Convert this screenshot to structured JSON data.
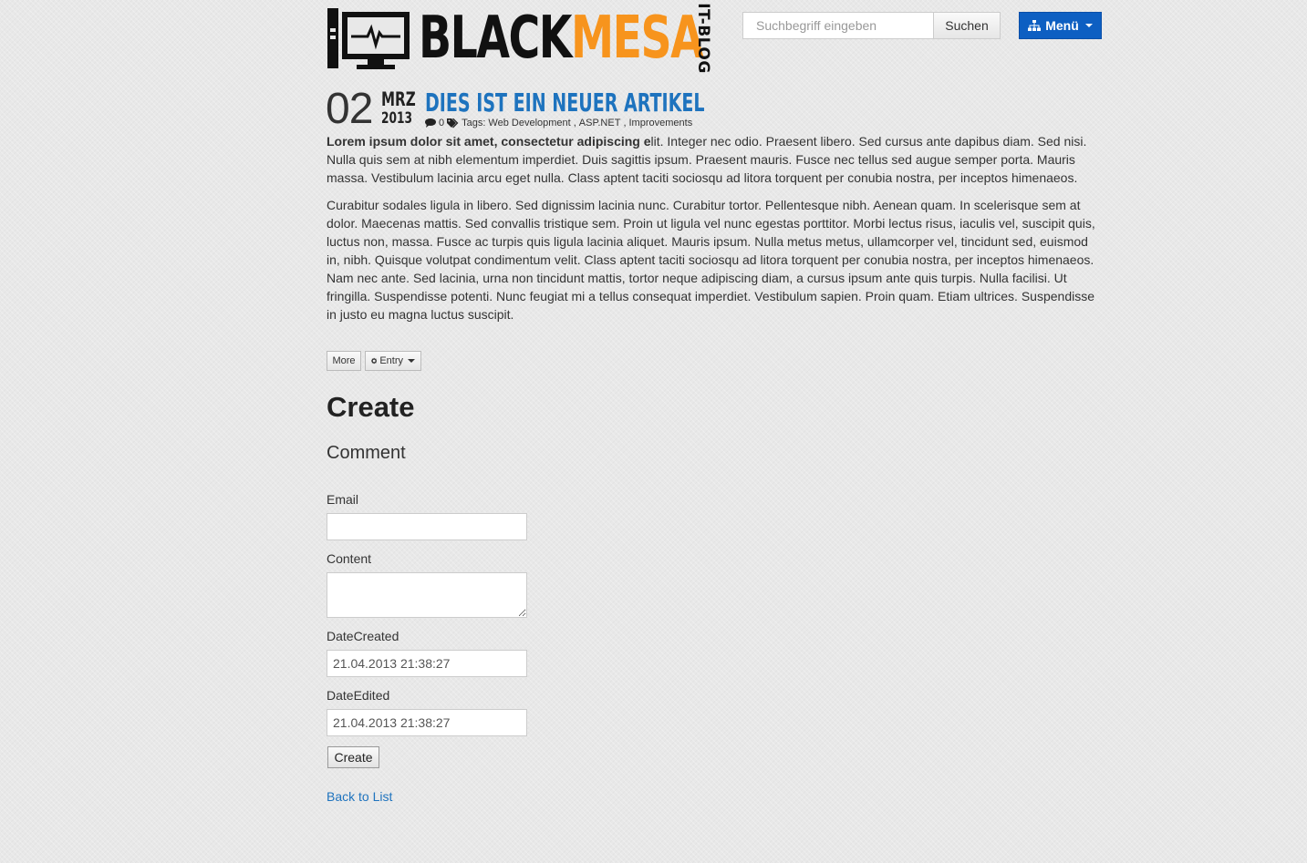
{
  "header": {
    "logo_black": "BLACK",
    "logo_mesa": "MESA",
    "logo_sub": "IT-BLOG",
    "search_placeholder": "Suchbegriff eingeben",
    "search_button": "Suchen",
    "menu_button": "Menü",
    "colors": {
      "accent": "#f7941d",
      "menu": "#0d5fc2",
      "link": "#1e73be"
    }
  },
  "article": {
    "day": "02",
    "month": "MRZ",
    "year": "2013",
    "title": "DIES IST EIN NEUER ARTIKEL",
    "comment_count": "0",
    "tags_label": "Tags:",
    "tags": [
      "Web Development",
      "ASP.NET",
      "Improvements"
    ],
    "p1_bold": "Lorem ipsum dolor sit amet, consectetur adipiscing e",
    "p1_rest": "lit. Integer nec odio. Praesent libero. Sed cursus ante dapibus diam. Sed nisi. Nulla quis sem at nibh elementum imperdiet. Duis sagittis ipsum. Praesent mauris. Fusce nec tellus sed augue semper porta. Mauris massa. Vestibulum lacinia arcu eget nulla. Class aptent taciti sociosqu ad litora torquent per conubia nostra, per inceptos himenaeos.",
    "p2": "Curabitur sodales ligula in libero. Sed dignissim lacinia nunc. Curabitur tortor. Pellentesque nibh. Aenean quam. In scelerisque sem at dolor. Maecenas mattis. Sed convallis tristique sem. Proin ut ligula vel nunc egestas porttitor. Morbi lectus risus, iaculis vel, suscipit quis, luctus non, massa. Fusce ac turpis quis ligula lacinia aliquet. Mauris ipsum. Nulla metus metus, ullamcorper vel, tincidunt sed, euismod in, nibh. Quisque volutpat condimentum velit. Class aptent taciti sociosqu ad litora torquent per conubia nostra, per inceptos himenaeos. Nam nec ante. Sed lacinia, urna non tincidunt mattis, tortor neque adipiscing diam, a cursus ipsum ante quis turpis. Nulla facilisi. Ut fringilla. Suspendisse potenti. Nunc feugiat mi a tellus consequat imperdiet. Vestibulum sapien. Proin quam. Etiam ultrices. Suspendisse in justo eu magna luctus suscipit.",
    "more_button": "More",
    "entry_button": "Entry"
  },
  "form": {
    "heading": "Create",
    "subheading": "Comment",
    "email_label": "Email",
    "email_value": "",
    "content_label": "Content",
    "content_value": "",
    "date_created_label": "DateCreated",
    "date_created_value": "21.04.2013 21:38:27",
    "date_edited_label": "DateEdited",
    "date_edited_value": "21.04.2013 21:38:27",
    "submit_button": "Create",
    "back_link": "Back to List"
  }
}
